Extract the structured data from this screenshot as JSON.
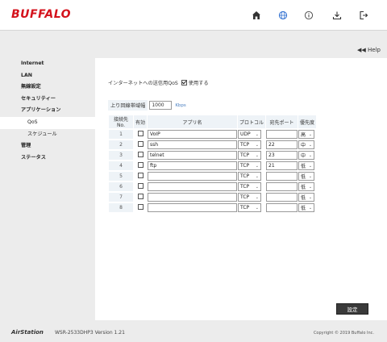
{
  "header": {
    "logo": "BUFFALO",
    "icons": [
      "home-icon",
      "globe-icon",
      "info-icon",
      "download-icon",
      "logout-icon"
    ],
    "accent_color": "#d4121c",
    "active_icon_color": "#2f6fd0"
  },
  "help": {
    "label": "◀◀ Help"
  },
  "sidebar": {
    "items": [
      {
        "label": "Internet"
      },
      {
        "label": "LAN"
      },
      {
        "label": "無線設定"
      },
      {
        "label": "セキュリティー"
      },
      {
        "label": "アプリケーション"
      },
      {
        "label": "QoS"
      },
      {
        "label": "スケジュール"
      },
      {
        "label": "管理"
      },
      {
        "label": "ステータス"
      }
    ]
  },
  "qos": {
    "label": "インターネットへの送信用QoS",
    "enable_label": "使用する",
    "enabled": true
  },
  "bandwidth": {
    "label": "上り回線帯域幅",
    "value": "1000",
    "unit": "Kbps"
  },
  "table": {
    "headers": [
      "接続先No.",
      "有効",
      "アプリ名",
      "プロトコル",
      "宛先ポート",
      "優先度"
    ],
    "rows": [
      {
        "no": "1",
        "app": "VoIP",
        "protocol": "UDP",
        "port": "",
        "priority": "高"
      },
      {
        "no": "2",
        "app": "ssh",
        "protocol": "TCP",
        "port": "22",
        "priority": "中"
      },
      {
        "no": "3",
        "app": "telnet",
        "protocol": "TCP",
        "port": "23",
        "priority": "中"
      },
      {
        "no": "4",
        "app": "ftp",
        "protocol": "TCP",
        "port": "21",
        "priority": "低"
      },
      {
        "no": "5",
        "app": "",
        "protocol": "TCP",
        "port": "",
        "priority": "低"
      },
      {
        "no": "6",
        "app": "",
        "protocol": "TCP",
        "port": "",
        "priority": "低"
      },
      {
        "no": "7",
        "app": "",
        "protocol": "TCP",
        "port": "",
        "priority": "低"
      },
      {
        "no": "8",
        "app": "",
        "protocol": "TCP",
        "port": "",
        "priority": "低"
      }
    ]
  },
  "save_label": "設定",
  "footer": {
    "brand": "AirStation",
    "model": "WSR-2533DHP3  Version 1.21",
    "copyright": "Copyright © 2019 Buffalo Inc."
  }
}
